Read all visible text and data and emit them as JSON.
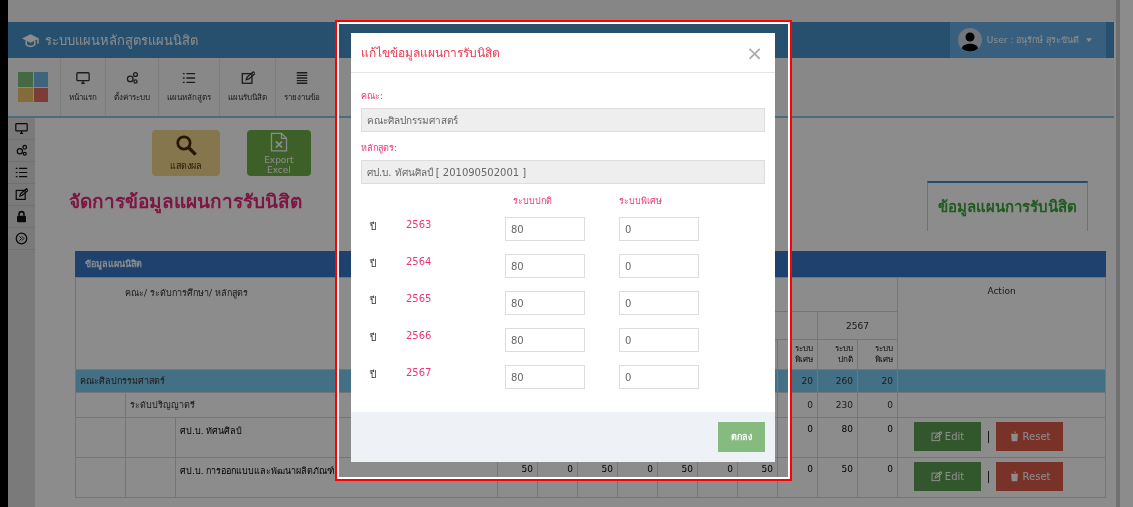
{
  "header": {
    "title": "ระบบแผนหลักสูตรแผนนิสิต",
    "user": "User : อนุรักษ์ สุระขันตี"
  },
  "toolbar": [
    {
      "kind": "monitor",
      "label": "หน้าแรก"
    },
    {
      "kind": "gears",
      "label": "ตั้งค่าระบบ"
    },
    {
      "kind": "list",
      "label": "แผนหลักสูตร"
    },
    {
      "kind": "edit",
      "label": "แผนรับนิสิต"
    },
    {
      "kind": "report",
      "label": "รายงานข้อ"
    }
  ],
  "sidebar": [
    {
      "kind": "monitor"
    },
    {
      "kind": "gears"
    },
    {
      "kind": "list"
    },
    {
      "kind": "edit"
    },
    {
      "kind": "lock"
    },
    {
      "kind": "expand"
    }
  ],
  "actions": [
    {
      "kind": "search",
      "label": "แสดงผล"
    },
    {
      "kind": "excel",
      "label": "Export Excel"
    }
  ],
  "heading": "จัดการข้อมูลแผนการรับนิสิต",
  "tabs": [
    {
      "label": "ข้อมูลแผนการรับนิสิต",
      "selected": true
    }
  ],
  "table": {
    "title": "ข้อมูลแผนนิสิต",
    "name_header": "คณะ/ ระดับการศึกษา/ หลักสูตร",
    "years": [
      "2567"
    ],
    "sub_headers": [
      "ระบบ พิเศษ",
      "ระบบ ปกติ",
      "ระบบ พิเศษ"
    ],
    "action_header": "Action",
    "rows": [
      {
        "kind": "faculty",
        "label": "คณะศิลปกรรมศาสตร์",
        "values": [
          "20",
          "260",
          "20"
        ]
      },
      {
        "kind": "level",
        "label": "ระดับปริญญาตรี",
        "values": [
          "0",
          "230",
          "0"
        ]
      },
      {
        "kind": "program",
        "label": "ศป.บ. ทัศนศิลป์",
        "values": [
          "0",
          "80",
          "0"
        ],
        "buttons": [
          "Edit",
          "Reset"
        ]
      },
      {
        "kind": "program",
        "label": "ศป.บ. การออกแบบและพัฒนาผลิตภัณฑ์",
        "values": [
          "50",
          "0",
          "50",
          "0",
          "50",
          "0",
          "50",
          "0",
          "50",
          "0"
        ],
        "buttons": [
          "Edit",
          "Reset"
        ]
      }
    ]
  },
  "modal": {
    "title": "แก้ไขข้อมูลแผนการรับนิสิต",
    "close": "×",
    "fields": [
      {
        "label": "คณะ:",
        "value": "คณะศิลปกรรมศาสตร์"
      },
      {
        "label": "หลักสูตร:",
        "value": "ศป.บ. ทัศนศิลป์ [ 201090502001 ]"
      }
    ],
    "column_heads": [
      "ระบบปกติ",
      "ระบบพิเศษ"
    ],
    "rows": [
      {
        "prefix": "ปี",
        "year": "2563",
        "normal": "80",
        "special": "0"
      },
      {
        "prefix": "ปี",
        "year": "2564",
        "normal": "80",
        "special": "0"
      },
      {
        "prefix": "ปี",
        "year": "2565",
        "normal": "80",
        "special": "0"
      },
      {
        "prefix": "ปี",
        "year": "2566",
        "normal": "80",
        "special": "0"
      },
      {
        "prefix": "ปี",
        "year": "2567",
        "normal": "80",
        "special": "0"
      }
    ],
    "confirm": "ตกลง"
  }
}
